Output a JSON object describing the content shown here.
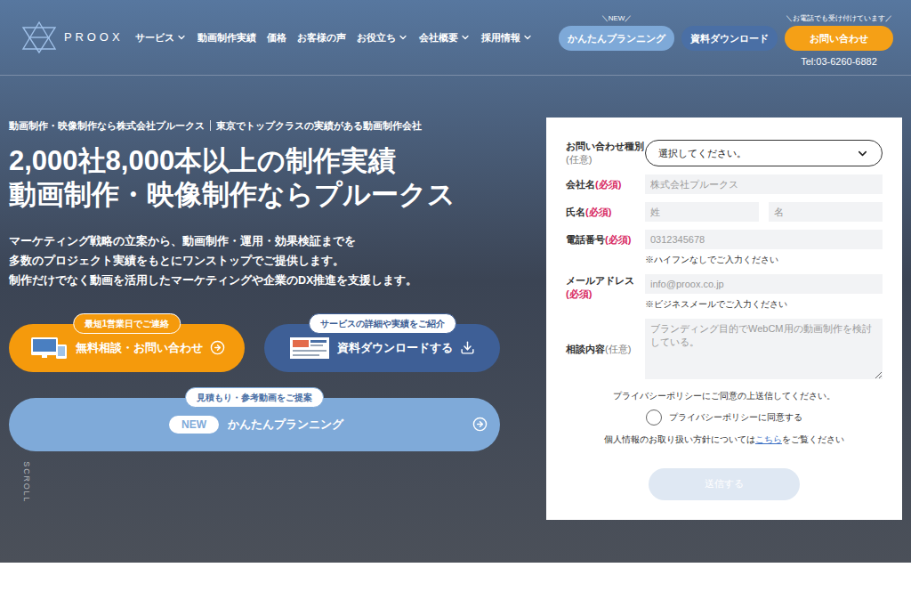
{
  "header": {
    "logo": "PROOX",
    "nav": [
      {
        "label": "サービス",
        "dropdown": true
      },
      {
        "label": "動画制作実績",
        "dropdown": false
      },
      {
        "label": "価格",
        "dropdown": false
      },
      {
        "label": "お客様の声",
        "dropdown": false
      },
      {
        "label": "お役立ち",
        "dropdown": true
      },
      {
        "label": "会社概要",
        "dropdown": true
      },
      {
        "label": "採用情報",
        "dropdown": true
      }
    ],
    "planning_button": {
      "label": "かんたんプランニング",
      "note": "＼NEW／"
    },
    "download_button": {
      "label": "資料ダウンロード"
    },
    "contact_button": {
      "label": "お問い合わせ",
      "note": "＼お電話でも受け付けています／"
    },
    "tel": "Tel:03-6260-6882"
  },
  "hero": {
    "lead": [
      "動画制作・映像制作なら株式会社プルークス",
      "東京でトップクラスの実績がある動画制作会社"
    ],
    "title": [
      "2,000社8,000本以上の制作実績",
      "動画制作・映像制作ならプルークス"
    ],
    "description": [
      "マーケティング戦略の立案から、動画制作・運用・効果検証までを",
      "多数のプロジェクト実績をもとにワンストップでご提供します。",
      "制作だけでなく動画を活用したマーケティングや企業のDX推進を支援します。"
    ],
    "cta": [
      {
        "kind": "contact",
        "badge": "最短1営業日でご連絡",
        "label": "無料相談・お問い合わせ"
      },
      {
        "kind": "download",
        "badge": "サービスの詳細や実績をご紹介",
        "label": "資料ダウンロードする"
      }
    ],
    "planning_cta": {
      "badge": "見積もり・参考動画をご提案",
      "tag": "NEW",
      "label": "かんたんプランニング"
    },
    "scroll": "SCROLL"
  },
  "form": {
    "fields": [
      {
        "label": "お問い合わせ種別",
        "tag": "(任意)",
        "required": false,
        "kind": "select",
        "value": "選択してください。",
        "placeholders": [],
        "note": ""
      },
      {
        "label": "会社名",
        "tag": "(必須)",
        "required": true,
        "kind": "text",
        "value": "",
        "placeholders": [
          "株式会社プルークス"
        ],
        "note": ""
      },
      {
        "label": "氏名",
        "tag": "(必須)",
        "required": true,
        "kind": "text",
        "value": "",
        "placeholders": [
          "姓",
          "名"
        ],
        "note": ""
      },
      {
        "label": "電話番号",
        "tag": "(必須)",
        "required": true,
        "kind": "text",
        "value": "",
        "placeholders": [
          "0312345678"
        ],
        "note": "※ハイフンなしでご入力ください"
      },
      {
        "label": "メールアドレス",
        "tag": "(必須)",
        "required": true,
        "kind": "text",
        "value": "",
        "placeholders": [
          "info@proox.co.jp"
        ],
        "note": "※ビジネスメールでご入力ください"
      },
      {
        "label": "相談内容",
        "tag": "(任意)",
        "required": false,
        "kind": "textarea",
        "value": "",
        "placeholders": [
          "ブランディング目的でWebCM用の動画制作を検討している。"
        ],
        "note": ""
      }
    ],
    "privacy_notice": "プライバシーポリシーにご同意の上送信してください。",
    "agree": {
      "label": "プライバシーポリシーに同意する",
      "checked": false
    },
    "policy_text": [
      "個人情報のお取り扱い方針については",
      "こちら",
      "をご覧ください"
    ],
    "submit": {
      "label": "送信する",
      "disabled": true
    }
  }
}
